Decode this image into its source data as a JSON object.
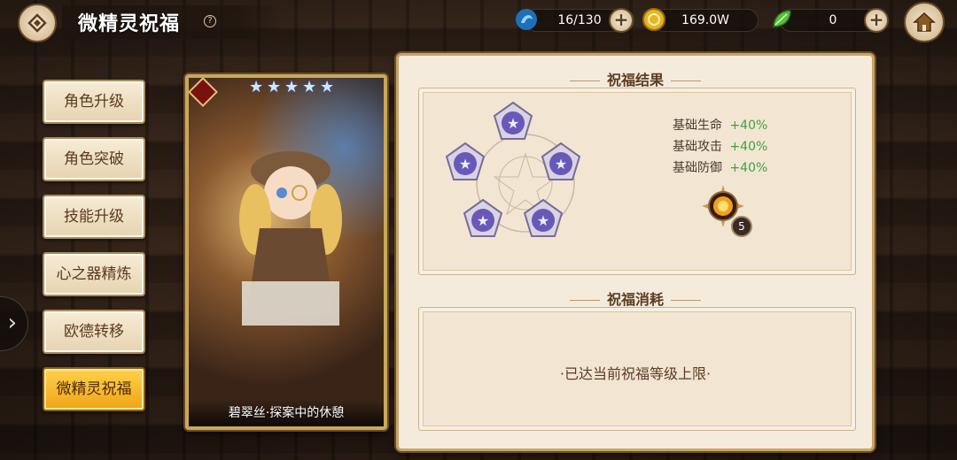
{
  "header": {
    "title": "微精灵祝福",
    "help_symbol": "?",
    "resources": [
      {
        "name": "stamina",
        "icon": "blue-dragon-icon",
        "value": "16/130",
        "color": "#4aa8e8"
      },
      {
        "name": "gold",
        "icon": "gold-coin-icon",
        "value": "169.0W",
        "color": "#f0c030"
      },
      {
        "name": "gem",
        "icon": "green-leaf-gem-icon",
        "value": "0",
        "color": "#5ac040"
      }
    ]
  },
  "sidebar": {
    "items": [
      {
        "label": "角色升级",
        "active": false
      },
      {
        "label": "角色突破",
        "active": false
      },
      {
        "label": "技能升级",
        "active": false
      },
      {
        "label": "心之器精炼",
        "active": false
      },
      {
        "label": "欧德转移",
        "active": false
      },
      {
        "label": "微精灵祝福",
        "active": true
      }
    ],
    "expand_symbol": "›"
  },
  "card": {
    "name": "碧翠丝·探案中的休憩",
    "star_count": 5,
    "star_symbol": "★"
  },
  "result": {
    "title": "祝福结果",
    "stats": [
      {
        "label": "基础生命",
        "value": "+40%"
      },
      {
        "label": "基础攻击",
        "value": "+40%"
      },
      {
        "label": "基础防御",
        "value": "+40%"
      }
    ],
    "buff_level": "5"
  },
  "cost": {
    "title": "祝福消耗",
    "message": "·已达当前祝福等级上限·"
  },
  "colors": {
    "accent_gold": "#f0a315",
    "panel_bg": "#f4ebdd",
    "stat_green": "#3ea33e",
    "brown_text": "#5c3c22"
  }
}
